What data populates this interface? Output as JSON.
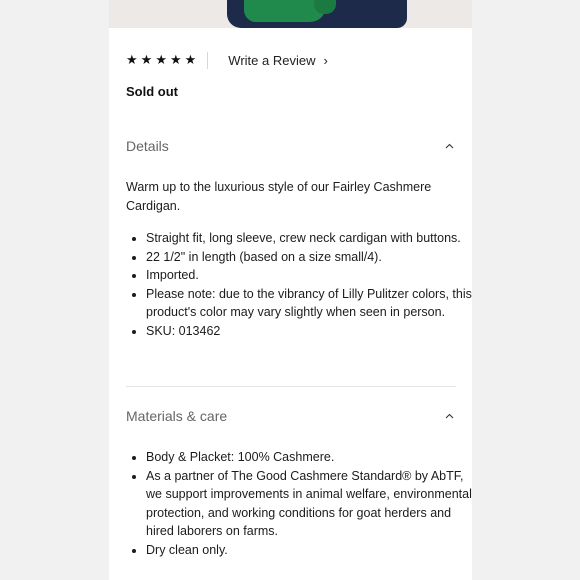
{
  "rating": {
    "stars": [
      "★",
      "★",
      "★",
      "★",
      "★"
    ],
    "write_review_label": "Write a Review",
    "chevron": "›"
  },
  "status": {
    "availability": "Sold out"
  },
  "details": {
    "title": "Details",
    "toggle_icon": "chevron-up-icon",
    "intro": "Warm up to the luxurious style of our Fairley Cashmere Cardigan.",
    "bullets": [
      "Straight fit, long sleeve, crew neck cardigan with buttons.",
      "22 1/2\" in length (based on a size small/4).",
      "Imported.",
      "Please note: due to the vibrancy of Lilly Pulitzer colors, this product's color may vary slightly when seen in person.",
      "SKU: 013462"
    ]
  },
  "materials": {
    "title": "Materials & care",
    "toggle_icon": "chevron-up-icon",
    "bullets": [
      "Body & Placket: 100% Cashmere.",
      "As a partner of The Good Cashmere Standard® by AbTF, we support improvements in animal welfare, environmental protection, and working conditions for goat herders and hired laborers on farms.",
      "Dry clean only."
    ]
  },
  "colors": {
    "panel_bg": "#ffffff",
    "page_bg": "#f1f1f1",
    "garment_green": "#1f8a4c",
    "garment_navy": "#1d2a4a"
  }
}
